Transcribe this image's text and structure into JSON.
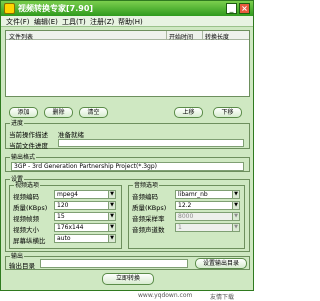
{
  "app": {
    "title": "视频转换专家[7.90]",
    "minimize": "_",
    "close": "×"
  },
  "menu": [
    "文件(F)",
    "编辑(E)",
    "工具(T)",
    "注册(Z)",
    "帮助(H)"
  ],
  "file_list": {
    "columns": [
      "文件列表",
      "开始时间",
      "转换长度"
    ]
  },
  "buttons": {
    "add": "添加",
    "delete": "删除",
    "clear": "清空",
    "move_up": "上移",
    "move_down": "下移",
    "set_output_dir": "设置输出目录",
    "convert": "立即转换"
  },
  "progress": {
    "legend": "进度",
    "current_label": "当前操作描述",
    "current_value": "准备就绪",
    "file_label": "当前文件进度"
  },
  "output_format": {
    "legend": "输出格式",
    "value": "3GP - 3rd Generation Partnership Project(*.3gp)"
  },
  "settings": {
    "legend": "设置",
    "video": {
      "legend": "视频选项",
      "rows": [
        {
          "label": "视频编码",
          "value": "mpeg4"
        },
        {
          "label": "质量(KBps)",
          "value": "120"
        },
        {
          "label": "视频帧频",
          "value": "15"
        },
        {
          "label": "视频大小",
          "value": "176x144"
        },
        {
          "label": "屏幕纵横比",
          "value": "auto"
        }
      ]
    },
    "audio": {
      "legend": "音频选项",
      "rows": [
        {
          "label": "音频编码",
          "value": "libamr_nb"
        },
        {
          "label": "质量(KBps)",
          "value": "12.2"
        },
        {
          "label": "音频采样率",
          "value": "8000"
        },
        {
          "label": "音频声道数",
          "value": "1"
        }
      ]
    }
  },
  "output": {
    "legend": "输出",
    "dir_label": "输出目录",
    "dir_value": ""
  },
  "watermark": {
    "site": "www.yqdown.com",
    "brand": "友情下载"
  },
  "colors": {
    "title_bar": "#2f9a1d",
    "window_bg": "#cfe8c2"
  }
}
